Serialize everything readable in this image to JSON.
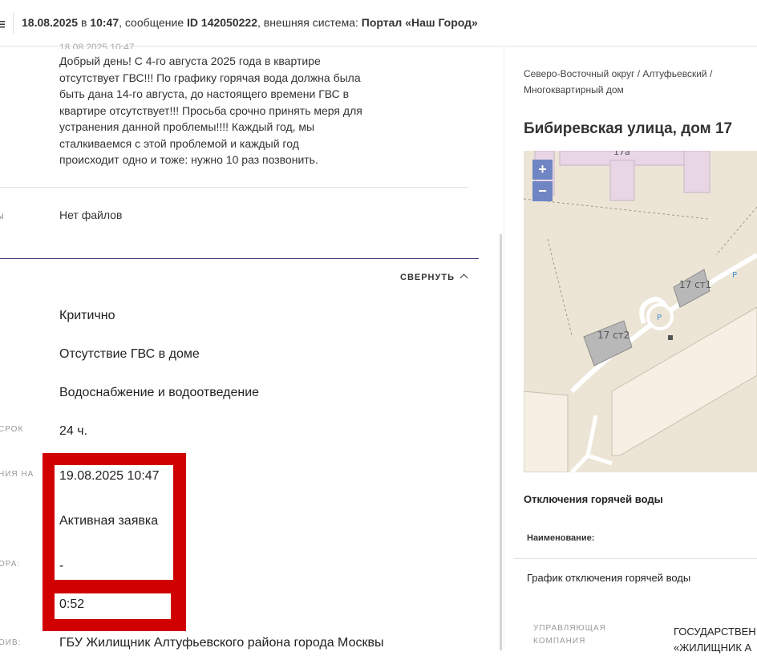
{
  "header": {
    "menu_icon": "hamburger-icon",
    "date_time": "18.08.2025",
    "at_word": " в ",
    "time": "10:47",
    "message_word": ", сообщение ",
    "id_label": "ID 142050222",
    "system_word": ", внешняя система: ",
    "system_name": "Портал «Наш Город»"
  },
  "message": {
    "date_cut": "18.08.2025 10:47",
    "lines": [
      "Добрый день! С 4-го августа 2025 года в квартире",
      "отсутствует ГВС!!! По графику горячая вода должна была",
      "быть дана 14-го августа, до настоящего времени ГВС в",
      "квартире отсутствует!!! Просьба срочно принять меря для",
      "устранения данной проблемы!!!! Каждый год, мы",
      "сталкиваемся с этой проблемой и каждый год",
      "происходит одно и тоже: нужно 10 раз позвонить."
    ]
  },
  "files": {
    "label": "ы",
    "value": "Нет файлов"
  },
  "collapse_label": "СВЕРНУТЬ",
  "details": [
    {
      "label": "",
      "value": "Критично"
    },
    {
      "label": ":",
      "value": "Отсутствие ГВС в доме"
    },
    {
      "label": "",
      "value": "Водоснабжение и водоотведение"
    },
    {
      "label": "СРОК",
      "value": "24 ч."
    },
    {
      "label": "НИЯ НА",
      "value": "19.08.2025 10:47"
    },
    {
      "label": "",
      "value": "Активная заявка"
    },
    {
      "label": "ОРА:",
      "value": "-"
    },
    {
      "label": "",
      "value": "0:52"
    },
    {
      "label": "ОИВ:",
      "value": "ГБУ Жилищник Алтуфьевского района города Москвы"
    }
  ],
  "right": {
    "breadcrumb_line1": "Северо-Восточный округ / Алтуфьевский /",
    "breadcrumb_line2": "Многоквартирный дом",
    "address": "Бибиревская улица, дом 17",
    "map": {
      "zoom_in": "+",
      "zoom_out": "−",
      "labels": [
        "17а",
        "17 ст1",
        "17 ст2"
      ],
      "parking": "P",
      "colors": {
        "bg": "#ece5d6",
        "building": "#e8d6e6",
        "block": "#f5f0e3",
        "gray": "#b8b8b8"
      }
    },
    "hot_water_title": "Отключения горячей воды",
    "name_label": "Наименование:",
    "schedule": "График отключения горячей воды",
    "mc_label_1": "УПРАВЛЯЮЩАЯ",
    "mc_label_2": "КОМПАНИЯ",
    "mc_value_1": "ГОСУДАРСТВЕН",
    "mc_value_2": "«ЖИЛИЩНИК А"
  },
  "colors": {
    "accent_line": "#3b3a80",
    "highlight": "#d10000"
  }
}
